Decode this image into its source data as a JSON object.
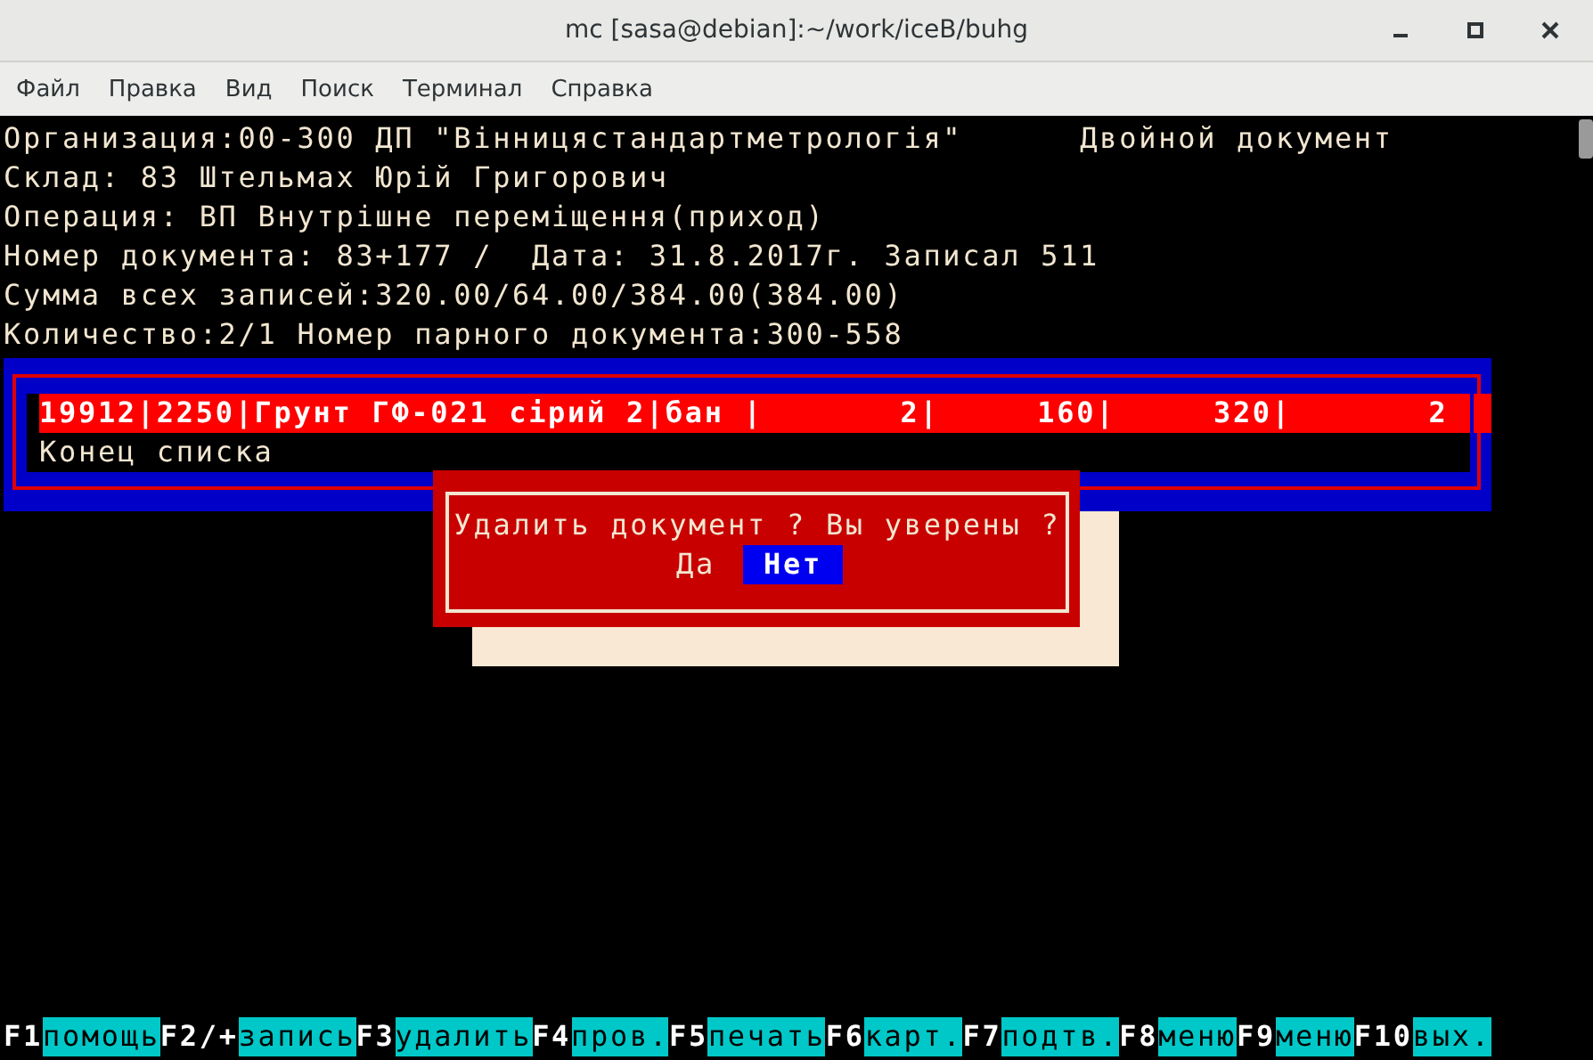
{
  "window": {
    "title": "mc [sasa@debian]:~/work/iceB/buhg"
  },
  "menu": [
    "Файл",
    "Правка",
    "Вид",
    "Поиск",
    "Терминал",
    "Справка"
  ],
  "header": {
    "lines": [
      "Организация:00-300 ДП \"Вінницястандартметрологія\"",
      "Склад: 83 Штельмах Юрій Григорович",
      "Операция: ВП Внутрішне переміщення(приход)",
      "Номер документа: 83+177 /  Дата: 31.8.2017г. Записал 511",
      "Сумма всех записей:320.00/64.00/384.00(384.00)",
      "Количество:2/1 Номер парного документа:300-558"
    ],
    "doc_type": "Двойной документ"
  },
  "list": {
    "rows": [
      {
        "text": "19912|2250|Грунт ГФ-021 сірий 2|бан |       2|     160|     320|       2",
        "selected": true
      },
      {
        "text": "Конец списка",
        "selected": false
      }
    ]
  },
  "dialog": {
    "message": "Удалить документ ? Вы уверены ?",
    "buttons": [
      {
        "label": "Да",
        "selected": false
      },
      {
        "label": "Нет",
        "selected": true
      }
    ]
  },
  "function_keys": [
    {
      "key": "F1",
      "label": "помощь"
    },
    {
      "key": "F2/+",
      "label": "запись"
    },
    {
      "key": "F3",
      "label": "удалить"
    },
    {
      "key": "F4",
      "label": "пров."
    },
    {
      "key": "F5",
      "label": "печать"
    },
    {
      "key": "F6",
      "label": "карт."
    },
    {
      "key": "F7",
      "label": "подтв."
    },
    {
      "key": "F8",
      "label": "меню"
    },
    {
      "key": "F9",
      "label": "меню"
    },
    {
      "key": "F10",
      "label": "вых."
    }
  ]
}
